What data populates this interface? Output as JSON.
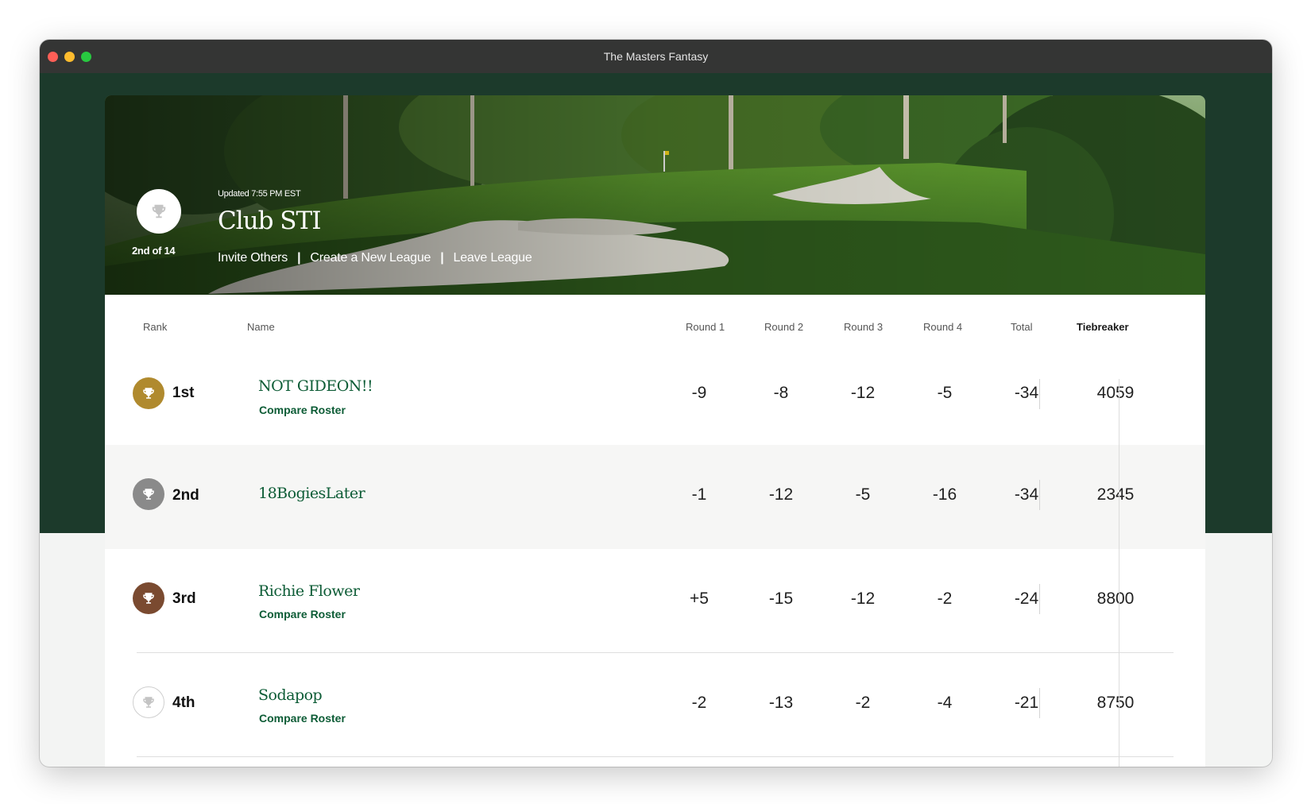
{
  "window": {
    "title": "The Masters Fantasy"
  },
  "hero": {
    "updated": "Updated 7:55 PM EST",
    "league_name": "Club STI",
    "standing": "2nd of 14",
    "links": [
      "Invite Others",
      "Create a New League",
      "Leave League"
    ],
    "separator": "|"
  },
  "table": {
    "columns": {
      "rank": "Rank",
      "name": "Name",
      "round1": "Round 1",
      "round2": "Round 2",
      "round3": "Round 3",
      "round4": "Round 4",
      "total": "Total",
      "tiebreaker": "Tiebreaker"
    },
    "rows": [
      {
        "rank": "1st",
        "trophy": "gold-trophy-icon",
        "name": "NOT GIDEON!!",
        "compare": "Compare Roster",
        "r1": "-9",
        "r2": "-8",
        "r3": "-12",
        "r4": "-5",
        "total": "-34",
        "tiebreaker": "4059"
      },
      {
        "rank": "2nd",
        "trophy": "silver-trophy-icon",
        "name": "18BogiesLater",
        "compare": "",
        "r1": "-1",
        "r2": "-12",
        "r3": "-5",
        "r4": "-16",
        "total": "-34",
        "tiebreaker": "2345"
      },
      {
        "rank": "3rd",
        "trophy": "bronze-trophy-icon",
        "name": "Richie Flower",
        "compare": "Compare Roster",
        "r1": "+5",
        "r2": "-15",
        "r3": "-12",
        "r4": "-2",
        "total": "-24",
        "tiebreaker": "8800"
      },
      {
        "rank": "4th",
        "trophy": "outline-trophy-icon",
        "name": "Sodapop",
        "compare": "Compare Roster",
        "r1": "-2",
        "r2": "-13",
        "r3": "-2",
        "r4": "-4",
        "total": "-21",
        "tiebreaker": "8750"
      }
    ]
  },
  "colors": {
    "brand_green": "#1c3a2b",
    "link_green": "#0d5c36",
    "gold": "#b08a2e",
    "silver": "#8a8a8a",
    "bronze": "#7a4a30"
  }
}
